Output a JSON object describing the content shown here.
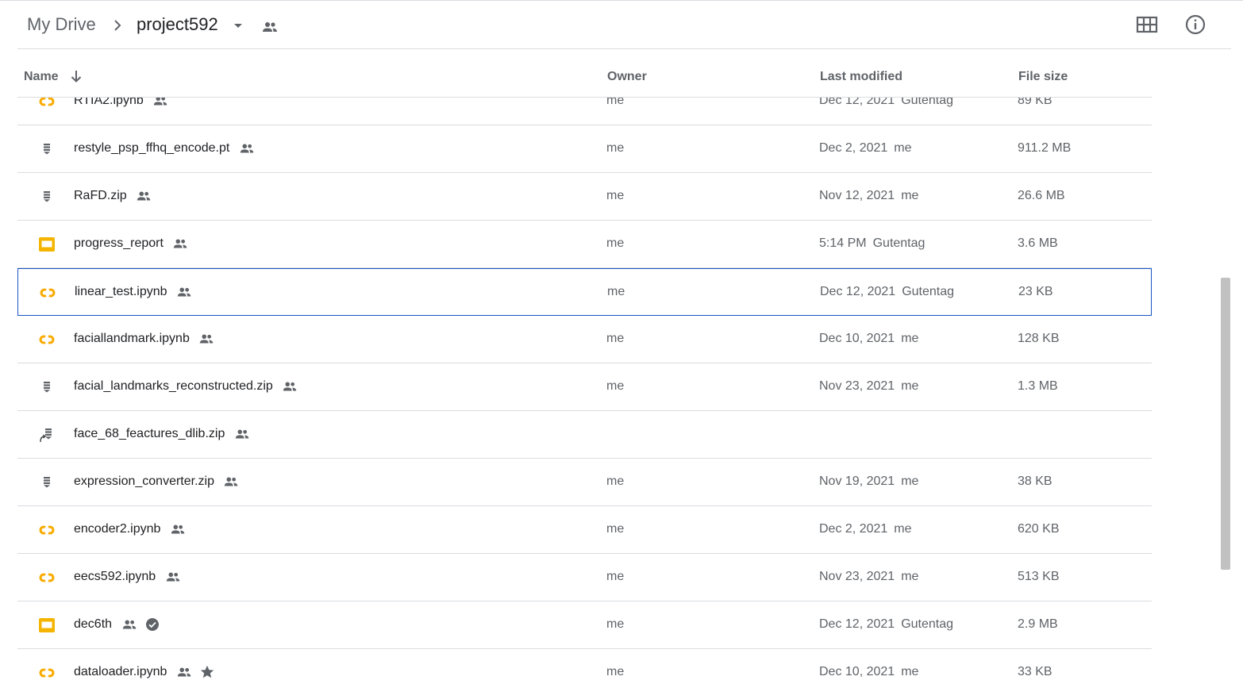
{
  "breadcrumb": {
    "root": "My Drive",
    "current": "project592"
  },
  "columns": {
    "name": "Name",
    "owner": "Owner",
    "last_modified": "Last modified",
    "file_size": "File size"
  },
  "colors": {
    "colab": "#f9ab00",
    "slides": "#f4b400",
    "selection": "#1a56c4",
    "text_primary": "#202124",
    "text_secondary": "#5f6368"
  },
  "files": [
    {
      "name": "RTIA2.ipynb",
      "icon": "colab-icon",
      "owner": "me",
      "modified_date": "Dec 12, 2021",
      "modified_by": "Gutentag",
      "size": "89 KB",
      "starred": false,
      "verified": false
    },
    {
      "name": "restyle_psp_ffhq_encode.pt",
      "icon": "file-icon",
      "owner": "me",
      "modified_date": "Dec 2, 2021",
      "modified_by": "me",
      "size": "911.2 MB",
      "starred": false,
      "verified": false
    },
    {
      "name": "RaFD.zip",
      "icon": "file-icon",
      "owner": "me",
      "modified_date": "Nov 12, 2021",
      "modified_by": "me",
      "size": "26.6 MB",
      "starred": false,
      "verified": false
    },
    {
      "name": "progress_report",
      "icon": "slides-icon",
      "owner": "me",
      "modified_date": "5:14 PM",
      "modified_by": "Gutentag",
      "size": "3.6 MB",
      "starred": false,
      "verified": false
    },
    {
      "name": "linear_test.ipynb",
      "icon": "colab-icon",
      "owner": "me",
      "modified_date": "Dec 12, 2021",
      "modified_by": "Gutentag",
      "size": "23 KB",
      "starred": false,
      "verified": false,
      "selected": true
    },
    {
      "name": "faciallandmark.ipynb",
      "icon": "colab-icon",
      "owner": "me",
      "modified_date": "Dec 10, 2021",
      "modified_by": "me",
      "size": "128 KB",
      "starred": false,
      "verified": false
    },
    {
      "name": "facial_landmarks_reconstructed.zip",
      "icon": "file-icon",
      "owner": "me",
      "modified_date": "Nov 23, 2021",
      "modified_by": "me",
      "size": "1.3 MB",
      "starred": false,
      "verified": false
    },
    {
      "name": "face_68_feactures_dlib.zip",
      "icon": "shortcut-file-icon",
      "owner": "",
      "modified_date": "",
      "modified_by": "",
      "size": "",
      "starred": false,
      "verified": false
    },
    {
      "name": "expression_converter.zip",
      "icon": "file-icon",
      "owner": "me",
      "modified_date": "Nov 19, 2021",
      "modified_by": "me",
      "size": "38 KB",
      "starred": false,
      "verified": false
    },
    {
      "name": "encoder2.ipynb",
      "icon": "colab-icon",
      "owner": "me",
      "modified_date": "Dec 2, 2021",
      "modified_by": "me",
      "size": "620 KB",
      "starred": false,
      "verified": false
    },
    {
      "name": "eecs592.ipynb",
      "icon": "colab-icon",
      "owner": "me",
      "modified_date": "Nov 23, 2021",
      "modified_by": "me",
      "size": "513 KB",
      "starred": false,
      "verified": false
    },
    {
      "name": "dec6th",
      "icon": "slides-icon",
      "owner": "me",
      "modified_date": "Dec 12, 2021",
      "modified_by": "Gutentag",
      "size": "2.9 MB",
      "starred": false,
      "verified": true
    },
    {
      "name": "dataloader.ipynb",
      "icon": "colab-icon",
      "owner": "me",
      "modified_date": "Dec 10, 2021",
      "modified_by": "me",
      "size": "33 KB",
      "starred": true,
      "verified": false
    }
  ]
}
